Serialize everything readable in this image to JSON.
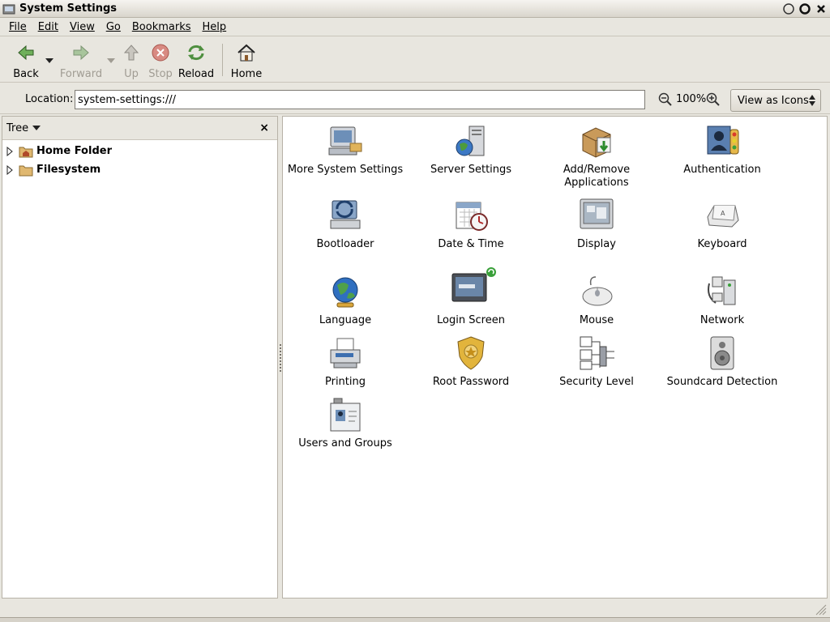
{
  "window": {
    "title": "System Settings"
  },
  "menubar": {
    "items": [
      "File",
      "Edit",
      "View",
      "Go",
      "Bookmarks",
      "Help"
    ]
  },
  "toolbar": {
    "back": "Back",
    "forward": "Forward",
    "up": "Up",
    "stop": "Stop",
    "reload": "Reload",
    "home": "Home"
  },
  "location": {
    "label": "Location:",
    "value": "system-settings:///",
    "zoom": "100%",
    "view_mode": "View as Icons"
  },
  "sidebar": {
    "title": "Tree",
    "items": [
      {
        "label": "Home Folder",
        "icon": "home-folder-icon"
      },
      {
        "label": "Filesystem",
        "icon": "folder-icon"
      }
    ]
  },
  "icons": [
    {
      "label": "More System Settings",
      "icon": "computer-settings-icon"
    },
    {
      "label": "Server Settings",
      "icon": "server-icon"
    },
    {
      "label": "Add/Remove Applications",
      "icon": "package-icon"
    },
    {
      "label": "Authentication",
      "icon": "authentication-icon"
    },
    {
      "label": "Bootloader",
      "icon": "bootloader-icon"
    },
    {
      "label": "Date & Time",
      "icon": "calendar-clock-icon"
    },
    {
      "label": "Display",
      "icon": "monitor-icon"
    },
    {
      "label": "Keyboard",
      "icon": "keyboard-key-icon"
    },
    {
      "label": "Language",
      "icon": "globe-icon"
    },
    {
      "label": "Login Screen",
      "icon": "login-screen-icon"
    },
    {
      "label": "Mouse",
      "icon": "mouse-icon"
    },
    {
      "label": "Network",
      "icon": "network-icon"
    },
    {
      "label": "Printing",
      "icon": "printer-icon"
    },
    {
      "label": "Root Password",
      "icon": "badge-icon"
    },
    {
      "label": "Security Level",
      "icon": "security-level-icon"
    },
    {
      "label": "Soundcard Detection",
      "icon": "speaker-icon"
    },
    {
      "label": "Users and Groups",
      "icon": "users-groups-icon"
    }
  ]
}
